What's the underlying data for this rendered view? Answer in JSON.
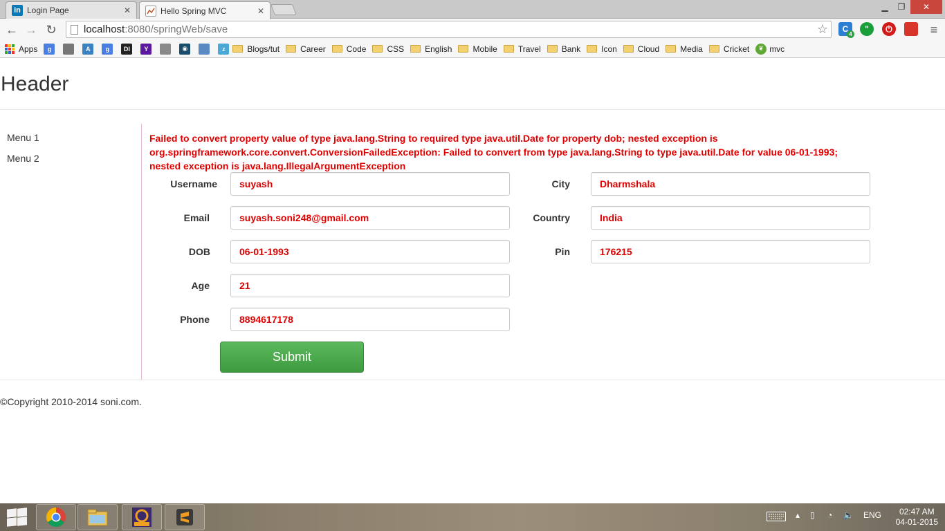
{
  "browser": {
    "tabs": [
      {
        "title": "Login Page",
        "favicon": "linkedin-icon"
      },
      {
        "title": "Hello Spring MVC",
        "favicon": "page-icon"
      }
    ],
    "url_host": "localhost",
    "url_rest": ":8080/springWeb/save",
    "bookmarks": [
      {
        "label": "Apps",
        "type": "apps"
      },
      {
        "label": "Blogs/tut",
        "type": "folder"
      },
      {
        "label": "Career",
        "type": "folder"
      },
      {
        "label": "Code",
        "type": "folder"
      },
      {
        "label": "CSS",
        "type": "folder"
      },
      {
        "label": "English",
        "type": "folder"
      },
      {
        "label": "Mobile",
        "type": "folder"
      },
      {
        "label": "Travel",
        "type": "folder"
      },
      {
        "label": "Bank",
        "type": "folder"
      },
      {
        "label": "Icon",
        "type": "folder"
      },
      {
        "label": "Cloud",
        "type": "folder"
      },
      {
        "label": "Media",
        "type": "folder"
      },
      {
        "label": "Cricket",
        "type": "folder"
      },
      {
        "label": "mvc",
        "type": "spring"
      }
    ],
    "bookmark_icons": [
      {
        "name": "google-icon",
        "glyph": "g",
        "color": "#4a7ee0"
      },
      {
        "name": "profile-icon",
        "glyph": "",
        "color": "#777777"
      },
      {
        "name": "translate-icon",
        "glyph": "A",
        "color": "#3b82c4"
      },
      {
        "name": "google-icon",
        "glyph": "g",
        "color": "#4a7ee0"
      },
      {
        "name": "di-icon",
        "glyph": "DI",
        "color": "#222222"
      },
      {
        "name": "yahoo-icon",
        "glyph": "Y",
        "color": "#5b1a9e"
      },
      {
        "name": "spider-icon",
        "glyph": "",
        "color": "#8a8a8a"
      },
      {
        "name": "camera-icon",
        "glyph": "",
        "color": "#1a4d6b"
      },
      {
        "name": "window-icon",
        "glyph": "",
        "color": "#5a8ac2"
      },
      {
        "name": "zen-icon",
        "glyph": "z",
        "color": "#4aa8d8"
      }
    ],
    "extension_badge": "4"
  },
  "page": {
    "header": "Header",
    "menu": [
      "Menu 1",
      "Menu 2"
    ],
    "error_line1": "Failed to convert property value of type java.lang.String to required type java.util.Date for property dob; nested exception is",
    "error_line2": "org.springframework.core.convert.ConversionFailedException: Failed to convert from type java.lang.String to type java.util.Date for value 06-01-1993;",
    "error_line3": "nested exception is java.lang.IllegalArgumentException",
    "form": {
      "username_label": "Username",
      "username": "suyash",
      "email_label": "Email",
      "email": "suyash.soni248@gmail.com",
      "dob_label": "DOB",
      "dob": "06-01-1993",
      "age_label": "Age",
      "age": "21",
      "phone_label": "Phone",
      "phone": "8894617178",
      "city_label": "City",
      "city": "Dharmshala",
      "country_label": "Country",
      "country": "India",
      "pin_label": "Pin",
      "pin": "176215",
      "submit_label": "Submit"
    },
    "footer": "©Copyright 2010-2014 soni.com."
  },
  "taskbar": {
    "language": "ENG",
    "time": "02:47 AM",
    "date": "04-01-2015"
  },
  "colors": {
    "error": "#e00000",
    "submit": "#4cae4c",
    "sidebar_border": "#e8b9d2"
  }
}
